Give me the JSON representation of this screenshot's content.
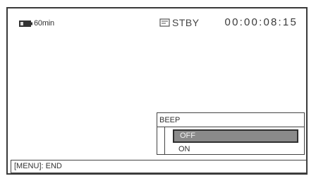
{
  "status": {
    "battery_remaining": "60min",
    "tape_status": "STBY",
    "timecode": "00:00:08:15"
  },
  "icons": {
    "battery": "battery-icon",
    "tape": "tape-cassette-icon"
  },
  "menu": {
    "title": "BEEP",
    "options": [
      {
        "label": "OFF",
        "selected": true
      },
      {
        "label": "ON",
        "selected": false
      }
    ]
  },
  "guide": {
    "text": "[MENU]: END"
  },
  "colors": {
    "selection_fill": "#8a8a8a",
    "frame": "#3a3a3a",
    "background": "#ffffff"
  }
}
